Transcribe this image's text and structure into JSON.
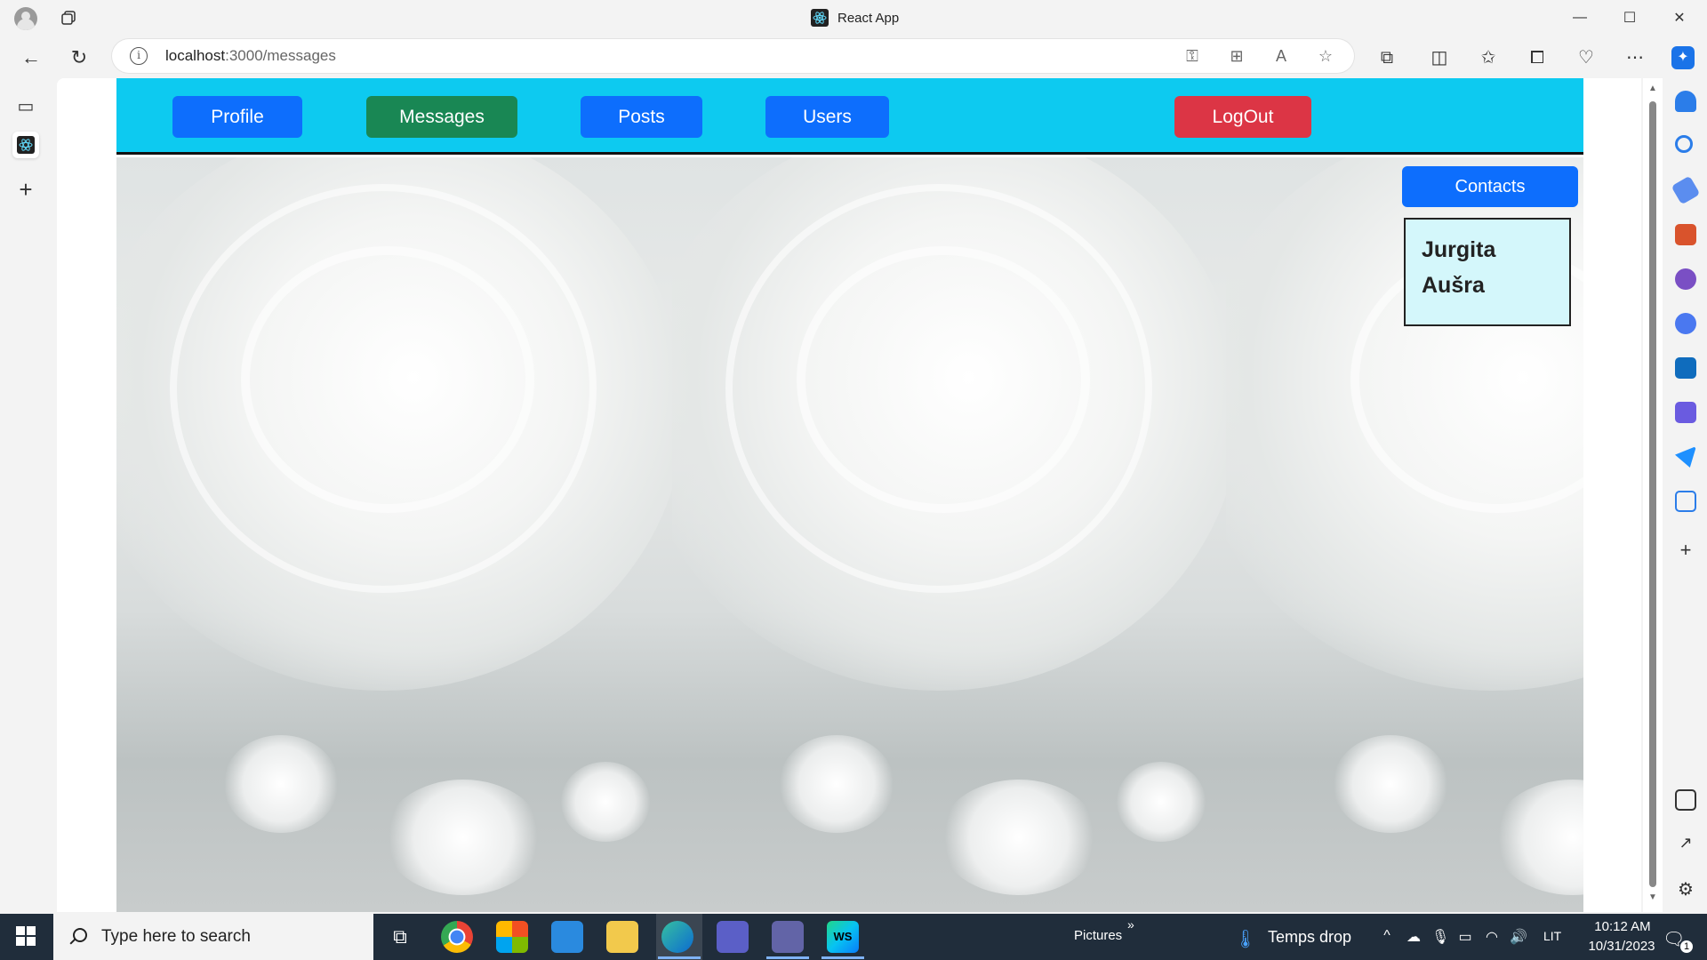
{
  "browser": {
    "title": "React App",
    "url_host": "localhost",
    "url_rest": ":3000/messages",
    "window_controls": {
      "minimize": "—",
      "maximize": "☐",
      "close": "✕"
    }
  },
  "app": {
    "nav": {
      "profile": "Profile",
      "messages": "Messages",
      "posts": "Posts",
      "users": "Users",
      "logout": "LogOut"
    },
    "contacts_button": "Contacts",
    "contacts": [
      "Jurgita",
      "Aušra"
    ],
    "colors": {
      "navbar": "#0dcaf0",
      "primary": "#0d6efd",
      "success": "#198754",
      "danger": "#dc3545",
      "contacts_box": "#d4f7fb"
    }
  },
  "taskbar": {
    "search_placeholder": "Type here to search",
    "pictures_label": "Pictures",
    "weather_text": "Temps drop",
    "language": "LIT",
    "time": "10:12 AM",
    "date": "10/31/2023",
    "notification_count": "1"
  }
}
